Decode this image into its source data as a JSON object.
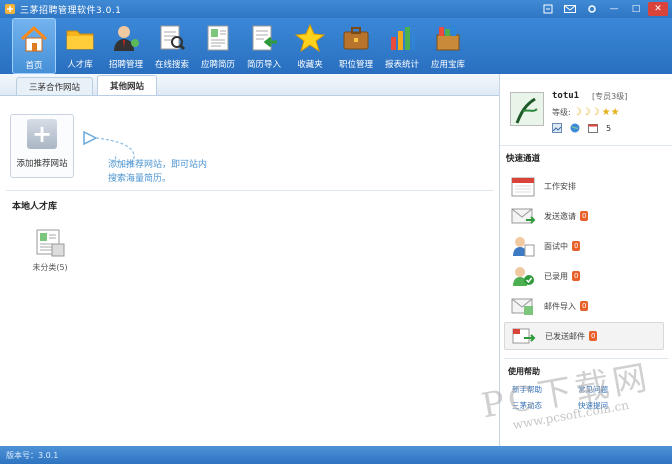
{
  "titlebar": {
    "title": "三茅招聘管理软件3.0.1"
  },
  "toolbar": {
    "items": [
      {
        "label": "首页",
        "icon": "home-icon"
      },
      {
        "label": "人才库",
        "icon": "folder-icon"
      },
      {
        "label": "招聘管理",
        "icon": "recruiter-icon"
      },
      {
        "label": "在线搜索",
        "icon": "search-document-icon"
      },
      {
        "label": "应聘简历",
        "icon": "resume-icon"
      },
      {
        "label": "简历导入",
        "icon": "import-icon"
      },
      {
        "label": "收藏夹",
        "icon": "star-icon"
      },
      {
        "label": "职位管理",
        "icon": "briefcase-icon"
      },
      {
        "label": "报表统计",
        "icon": "bar-chart-icon"
      },
      {
        "label": "应用宝库",
        "icon": "app-store-icon"
      }
    ]
  },
  "tabs": [
    {
      "label": "三茅合作网站"
    },
    {
      "label": "其他网站"
    }
  ],
  "add_site": {
    "label": "添加推荐网站"
  },
  "hint": {
    "line1": "添加推荐网站，即可站内",
    "line2": "搜索海量简历。"
  },
  "talent": {
    "section_title": "本地人才库",
    "uncategorized_label": "未分类(5)"
  },
  "user": {
    "name": "totu1",
    "role": "[专员3级]",
    "level_label": "等级:",
    "count": "5"
  },
  "quick": {
    "title": "快速通道",
    "items": [
      {
        "label": "工作安排",
        "badge": ""
      },
      {
        "label": "发送邀请",
        "badge": "0"
      },
      {
        "label": "面试中",
        "badge": "0"
      },
      {
        "label": "已录用",
        "badge": "0"
      },
      {
        "label": "邮件导入",
        "badge": "0"
      },
      {
        "label": "已发送邮件",
        "badge": "0"
      }
    ]
  },
  "help": {
    "title": "使用帮助",
    "links": [
      "新手帮助",
      "三茅动态",
      "常见问题",
      "快速提问"
    ]
  },
  "status": {
    "version": "版本号：3.0.1"
  },
  "watermark": {
    "big": "PC下载网",
    "url": "www.pcsoft.com.cn"
  }
}
